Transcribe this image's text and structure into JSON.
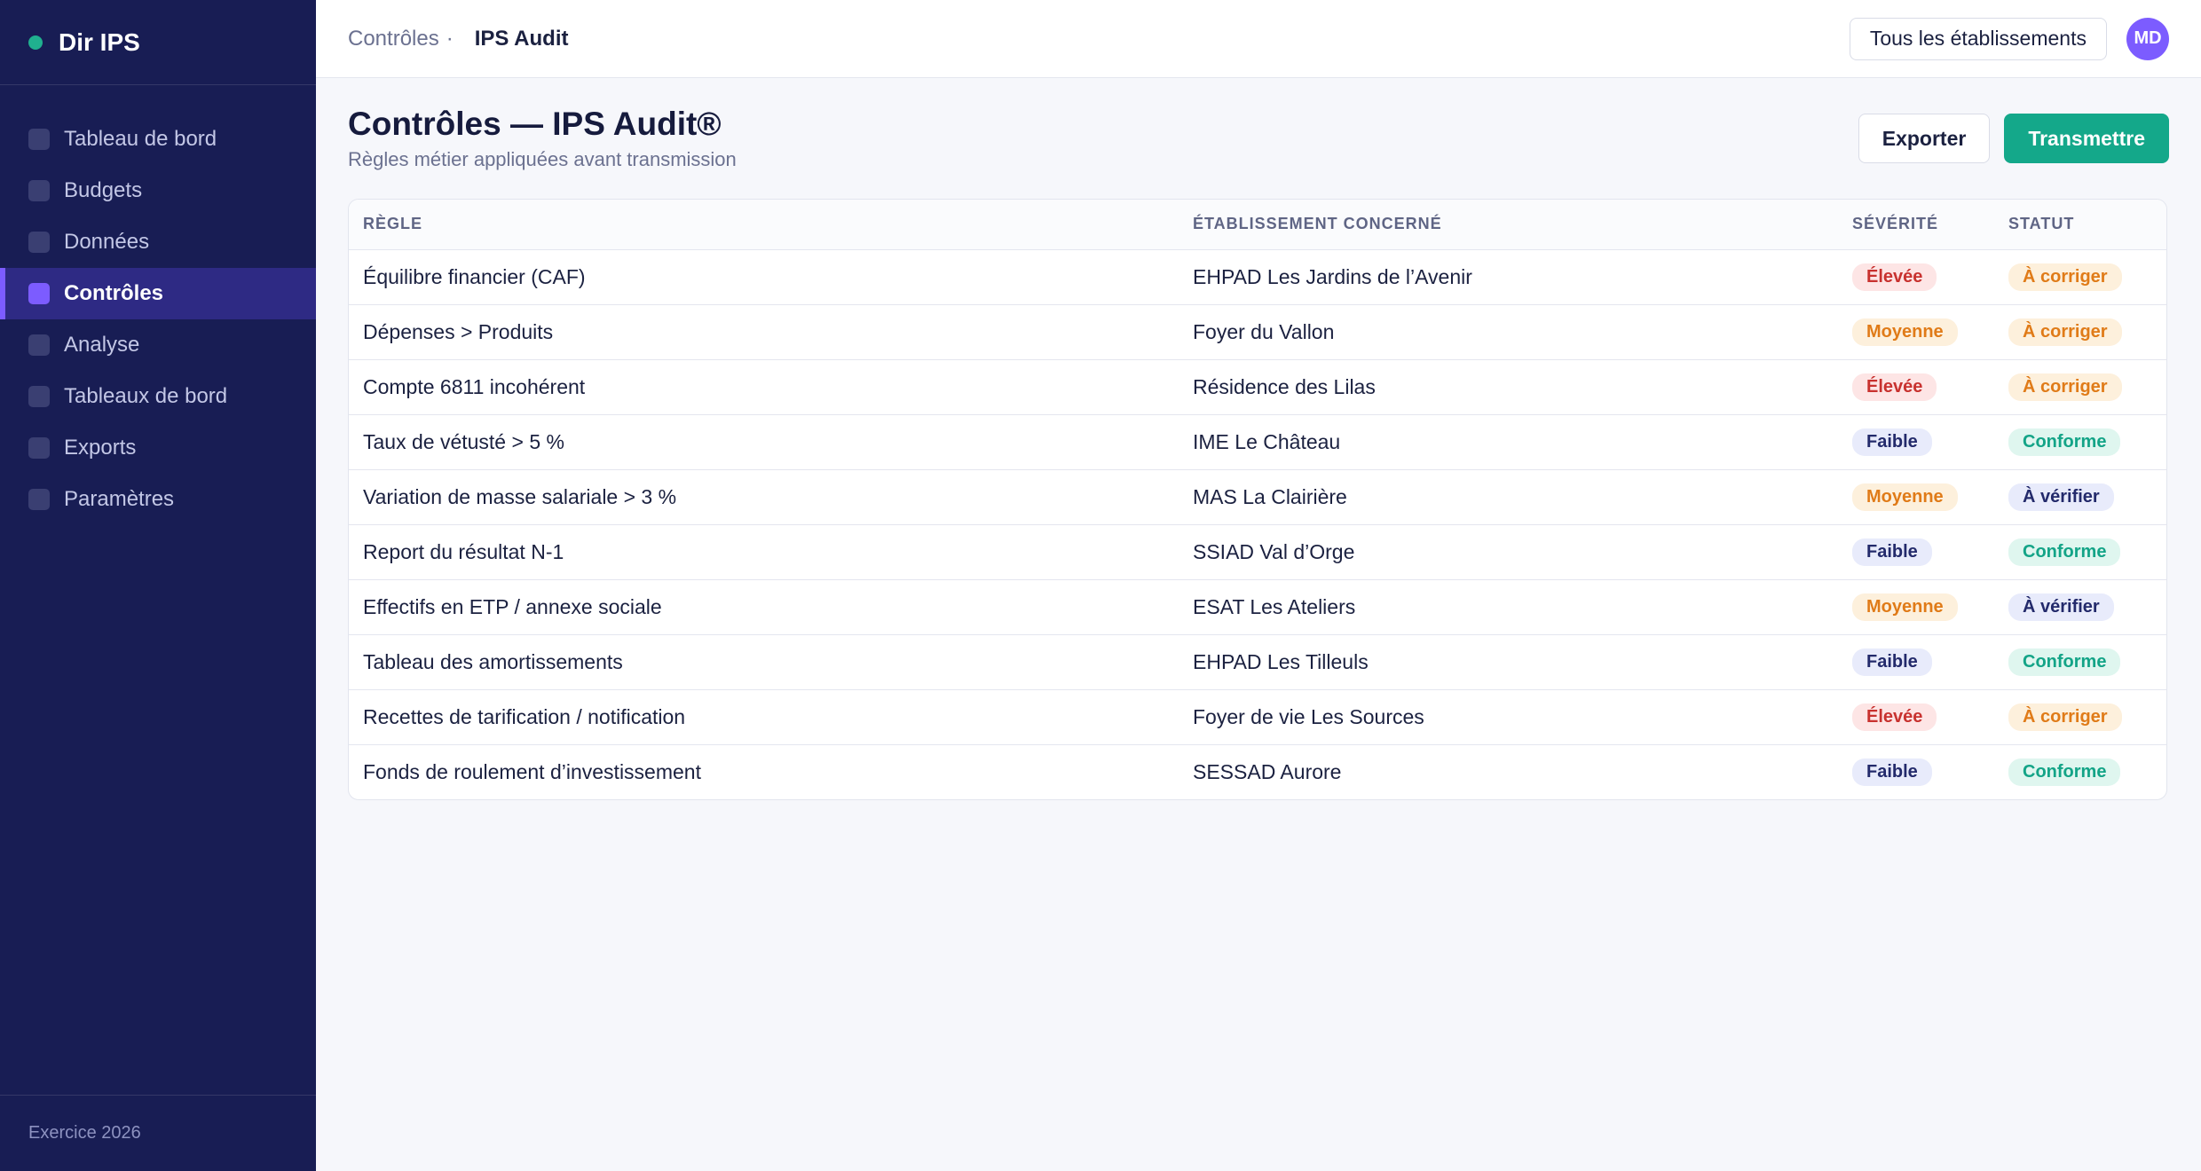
{
  "app": {
    "brand_name": "Dir IPS",
    "brand_dot_color": "#20b08f"
  },
  "sidebar": {
    "items": [
      {
        "label": "Tableau de bord",
        "active": false
      },
      {
        "label": "Budgets",
        "active": false
      },
      {
        "label": "Données",
        "active": false
      },
      {
        "label": "Contrôles",
        "active": true
      },
      {
        "label": "Analyse",
        "active": false
      },
      {
        "label": "Tableaux de bord",
        "active": false
      },
      {
        "label": "Exports",
        "active": false
      },
      {
        "label": "Paramètres",
        "active": false
      }
    ],
    "footer": "Exercice 2026"
  },
  "topbar": {
    "breadcrumb_parent": "Contrôles",
    "breadcrumb_separator": "·",
    "breadcrumb_current": "IPS Audit",
    "establishment_filter": "Tous les établissements",
    "avatar_initials": "MD"
  },
  "page": {
    "title": "Contrôles — IPS Audit®",
    "subtitle": "Règles métier appliquées avant transmission",
    "export_label": "Exporter",
    "send_label": "Transmettre"
  },
  "table": {
    "headers": {
      "rule": "RÈGLE",
      "establishment": "ÉTABLISSEMENT CONCERNÉ",
      "severity": "SÉVÉRITÉ",
      "status": "STATUT"
    },
    "rows": [
      {
        "rule": "Équilibre financier (CAF)",
        "establishment": "EHPAD Les Jardins de l’Avenir",
        "severity": "Élevée",
        "severity_level": "high",
        "status": "À corriger",
        "status_kind": "fix"
      },
      {
        "rule": "Dépenses > Produits",
        "establishment": "Foyer du Vallon",
        "severity": "Moyenne",
        "severity_level": "mid",
        "status": "À corriger",
        "status_kind": "fix"
      },
      {
        "rule": "Compte 6811 incohérent",
        "establishment": "Résidence des Lilas",
        "severity": "Élevée",
        "severity_level": "high",
        "status": "À corriger",
        "status_kind": "fix"
      },
      {
        "rule": "Taux de vétusté > 5 %",
        "establishment": "IME Le Château",
        "severity": "Faible",
        "severity_level": "low",
        "status": "Conforme",
        "status_kind": "ok"
      },
      {
        "rule": "Variation de masse salariale > 3 %",
        "establishment": "MAS La Clairière",
        "severity": "Moyenne",
        "severity_level": "mid",
        "status": "À vérifier",
        "status_kind": "check"
      },
      {
        "rule": "Report du résultat N-1",
        "establishment": "SSIAD Val d’Orge",
        "severity": "Faible",
        "severity_level": "low",
        "status": "Conforme",
        "status_kind": "ok"
      },
      {
        "rule": "Effectifs en ETP / annexe sociale",
        "establishment": "ESAT Les Ateliers",
        "severity": "Moyenne",
        "severity_level": "mid",
        "status": "À vérifier",
        "status_kind": "check"
      },
      {
        "rule": "Tableau des amortissements",
        "establishment": "EHPAD Les Tilleuls",
        "severity": "Faible",
        "severity_level": "low",
        "status": "Conforme",
        "status_kind": "ok"
      },
      {
        "rule": "Recettes de tarification / notification",
        "establishment": "Foyer de vie Les Sources",
        "severity": "Élevée",
        "severity_level": "high",
        "status": "À corriger",
        "status_kind": "fix"
      },
      {
        "rule": "Fonds de roulement d’investissement",
        "establishment": "SESSAD Aurore",
        "severity": "Faible",
        "severity_level": "low",
        "status": "Conforme",
        "status_kind": "ok"
      }
    ]
  },
  "colors": {
    "sidebar_bg": "#181d54",
    "active_accent": "#7c5cff",
    "primary_button": "#14a88a",
    "severity_high": "#c8322f",
    "severity_mid": "#e07b18",
    "severity_low": "#232a6b",
    "status_ok": "#13a487"
  }
}
